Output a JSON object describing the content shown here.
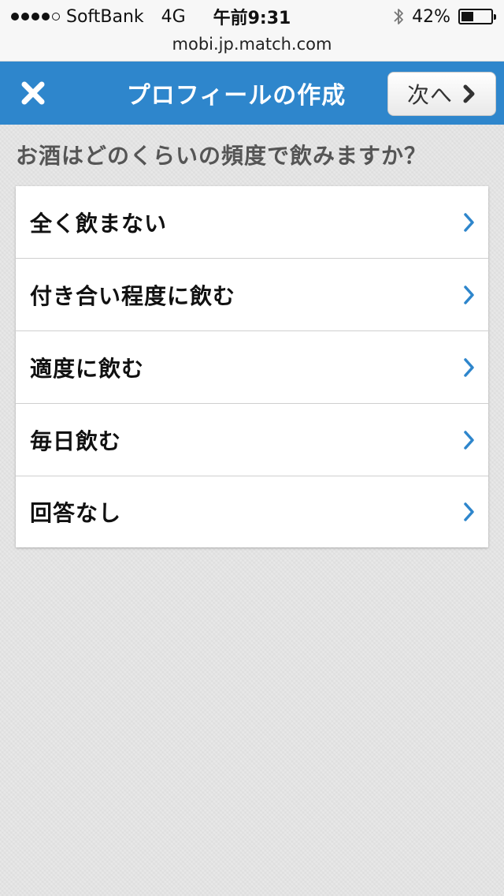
{
  "status_bar": {
    "carrier": "SoftBank",
    "network": "4G",
    "time": "午前9:31",
    "battery_text": "42%",
    "battery_level": 0.42,
    "signal_bars_filled": 4,
    "signal_bars_total": 5
  },
  "browser": {
    "url": "mobi.jp.match.com"
  },
  "nav": {
    "title": "プロフィールの作成",
    "next_label": "次へ"
  },
  "question": {
    "text": "お酒はどのくらいの頻度で飲みますか？"
  },
  "options": [
    {
      "label": "全く飲まない"
    },
    {
      "label": "付き合い程度に飲む"
    },
    {
      "label": "適度に飲む"
    },
    {
      "label": "毎日飲む"
    },
    {
      "label": "回答なし"
    }
  ],
  "colors": {
    "nav_blue": "#2e86cc",
    "chevron_blue": "#2e86cc",
    "background": "#e6e6e6"
  },
  "icons": {
    "close": "close-icon",
    "next_chevron": "chevron-right-icon",
    "option_chevron": "chevron-right-icon",
    "bluetooth": "bluetooth-icon",
    "battery": "battery-icon"
  }
}
